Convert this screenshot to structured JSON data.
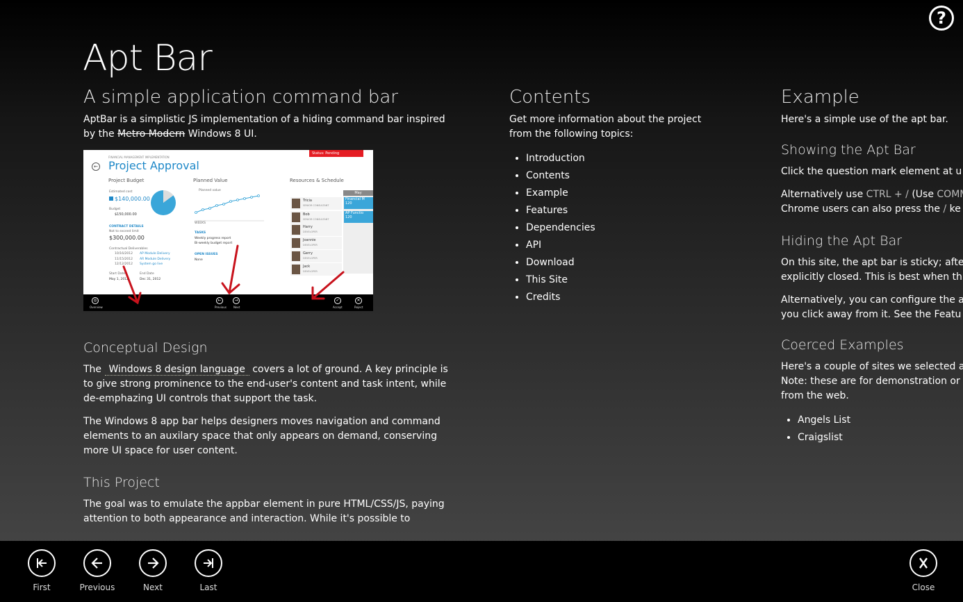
{
  "help_button": "?",
  "title": "Apt Bar",
  "col1": {
    "subtitle": "A simple application command bar",
    "intro_part1": "AptBar is a simplistic JS implementation of a hiding command bar inspired by the ",
    "intro_struck": "Metro Modern",
    "intro_part2": " Windows 8 UI.",
    "thumbnail": {
      "status": "Status: Pending",
      "breadcrumb": "FINANCIAL MANAGEMENT IMPLEMENTATION",
      "title": "Project Approval",
      "project_budget": "Project Budget",
      "estimated_cost_label": "Estimated cost",
      "estimated_cost": "$140,000.00",
      "budget_label": "Budget",
      "budget": "$150,000.00",
      "contract_details": "CONTRACT DETAILS",
      "not_to_exceed_label": "Not to exceed limit",
      "not_to_exceed": "$300,000.00",
      "contractual_deliverables": "Contractual Deliverables",
      "deliverables": [
        {
          "date": "10/16/2012",
          "name": "AP Module Delivery"
        },
        {
          "date": "11/15/2012",
          "name": "AR Module Delivery"
        },
        {
          "date": "12/12/2012",
          "name": "System go live"
        }
      ],
      "start_date_label": "Start Date",
      "start_date": "May 1, 2012",
      "end_date_label": "End Date",
      "end_date": "Dec 31, 2012",
      "planned_value": "Planned Value",
      "planned_value_legend": "Planned value",
      "weeks_label": "WEEKS",
      "tasks_label": "TASKS",
      "tasks": [
        "Weekly progress report",
        "Bi-weekly budget report"
      ],
      "open_issues_label": "OPEN ISSUES",
      "open_issues": "None",
      "resources_schedule": "Resources & Schedule",
      "may_label": "May",
      "people": [
        {
          "name": "Tricia",
          "role": "SENIOR CONSULTANT"
        },
        {
          "name": "Bob",
          "role": "SENIOR CONSULTANT"
        },
        {
          "name": "Harry",
          "role": "DEVELOPER"
        },
        {
          "name": "Joannie",
          "role": "DEVELOPER"
        },
        {
          "name": "Gerry",
          "role": "DEVELOPER"
        },
        {
          "name": "Jack",
          "role": "DEVELOPER"
        }
      ],
      "tasks_grid": [
        {
          "name": "Financial M",
          "value": "120"
        },
        {
          "name": "AP Functio",
          "value": "120"
        }
      ],
      "appbar": {
        "overview": "Overview",
        "previous": "Previous",
        "next": "Next",
        "accept": "Accept",
        "reject": "Reject"
      }
    },
    "conceptual_design": "Conceptual Design",
    "cd_p1_part1": "The ",
    "cd_p1_link": "Windows 8 design language",
    "cd_p1_part2": " covers a lot of ground. A key principle is to give strong prominence to the end-user's content and task intent, while de-emphazing UI controls that support the task.",
    "cd_p2": "The Windows 8 app bar helps designers moves navigation and command elements to an auxilary space that only appears on demand, conserving more UI space for user content.",
    "this_project": "This Project",
    "tp_p1": "The goal was to emulate the appbar element in pure HTML/CSS/JS, paying attention to both appearance and interaction. While it's possible to"
  },
  "col2": {
    "heading": "Contents",
    "intro_line1": "Get more information about the project",
    "intro_line2": "from the following topics:",
    "items": [
      "Introduction",
      "Contents",
      "Example",
      "Features",
      "Dependencies",
      "API",
      "Download",
      "This Site",
      "Credits"
    ]
  },
  "col3": {
    "heading": "Example",
    "intro": "Here's a simple use of the apt bar.",
    "showing_heading": "Showing the Apt Bar",
    "showing_p1": "Click the question mark element at u",
    "showing_p2_part1": "Alternatively use ",
    "showing_p2_keys1": "CTRL + /",
    "showing_p2_part2": " (Use ",
    "showing_p2_keys2": "COMM",
    "showing_p3_part1": "Chrome users can also press the ",
    "showing_p3_key": "/",
    "showing_p3_part2": " ke",
    "hiding_heading": "Hiding the Apt Bar",
    "hiding_p1_line1": "On this site, the apt bar is sticky; afte",
    "hiding_p1_line2": "explicitly closed. This is best when th",
    "hiding_p2_line1": "Alternatively, you can configure the a",
    "hiding_p2_line2": "you click away from it. See the Featu",
    "coerced_heading": "Coerced Examples",
    "coerced_line1": "Here's a couple of sites we selected a",
    "coerced_line2": "Note: these are for demonstration or",
    "coerced_line3": "from the web.",
    "sites": [
      "Angels List",
      "Craigslist"
    ]
  },
  "appbar": {
    "first": "First",
    "previous": "Previous",
    "next": "Next",
    "last": "Last",
    "close": "Close"
  }
}
